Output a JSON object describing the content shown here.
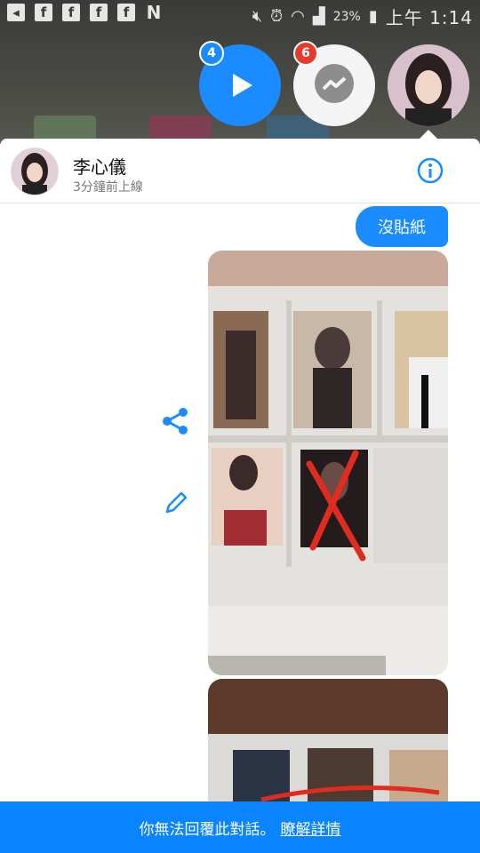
{
  "status_bar": {
    "notification_icons": [
      "back-icon",
      "facebook-icon",
      "facebook-icon",
      "facebook-icon",
      "facebook-icon",
      "n-icon"
    ],
    "battery": "23%",
    "time": "上午 1:14"
  },
  "chat_heads": {
    "play_badge": "4",
    "messenger_badge": "6"
  },
  "conversation": {
    "contact_name": "李心儀",
    "contact_status": "3分鐘前上線",
    "messages": [
      {
        "type": "text",
        "text": "沒貼紙",
        "from": "me"
      },
      {
        "type": "photo",
        "from": "me"
      },
      {
        "type": "photo",
        "from": "me"
      }
    ]
  },
  "footer": {
    "notice": "你無法回覆此對話。",
    "link": "瞭解詳情"
  },
  "colors": {
    "accent": "#1a8cff",
    "footer": "#0a84ff",
    "badge_red": "#e53b2f"
  }
}
